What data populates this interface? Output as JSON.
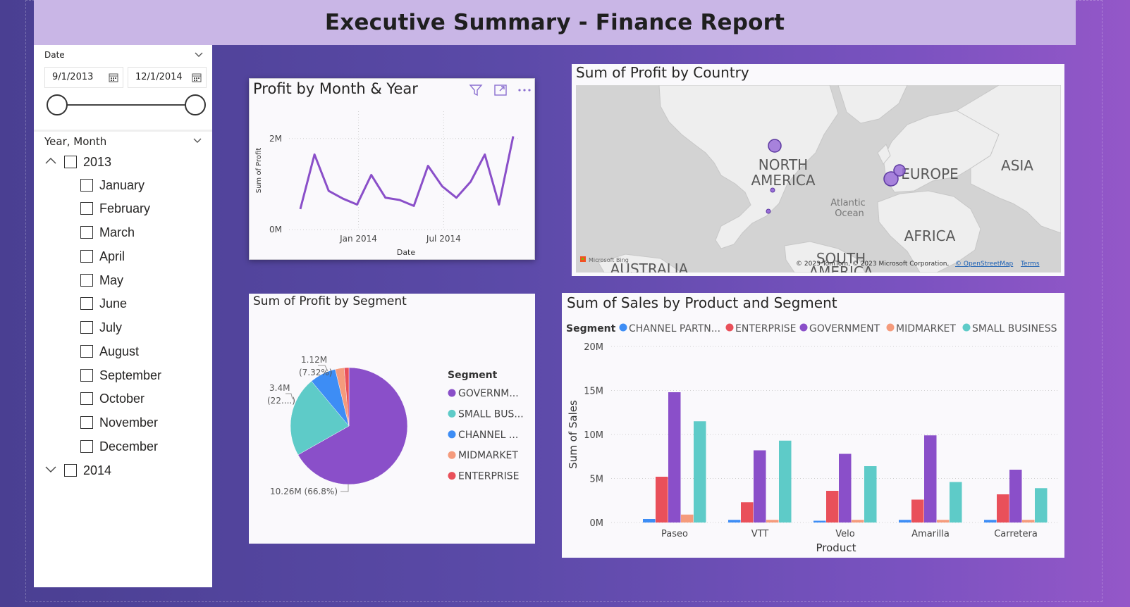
{
  "report": {
    "title": "Executive Summary - Finance Report"
  },
  "date_slicer": {
    "header": "Date",
    "start_date": "9/1/2013",
    "end_date": "12/1/2014",
    "range_fraction": [
      0.0,
      1.0
    ]
  },
  "hierarchy_slicer": {
    "header": "Year, Month",
    "years": [
      {
        "label": "2013",
        "expanded": true,
        "months": [
          "January",
          "February",
          "March",
          "April",
          "May",
          "June",
          "July",
          "August",
          "September",
          "October",
          "November",
          "December"
        ]
      },
      {
        "label": "2014",
        "expanded": false,
        "months": []
      }
    ]
  },
  "line_visual": {
    "title": "Profit by Month & Year",
    "header_icons": [
      "filter-icon",
      "focus-mode-icon",
      "more-options-icon"
    ]
  },
  "map_visual": {
    "title": "Sum of Profit by Country",
    "labels": [
      "NORTH AMERICA",
      "EUROPE",
      "ASIA",
      "Atlantic Ocean",
      "AFRICA",
      "SOUTH AMERICA",
      "AUSTRALIA"
    ],
    "label_lines": {
      "north_america": [
        "NORTH",
        "AMERICA"
      ],
      "atlantic": [
        "Atlantic",
        "Ocean"
      ],
      "south_america": [
        "SOUTH",
        "AMERICA"
      ]
    },
    "attribution": {
      "bing": "Microsoft Bing",
      "copyright": "© 2023 TomTom, © 2023 Microsoft Corporation,",
      "osm": "© OpenStreetMap",
      "terms": "Terms"
    },
    "bubbles": [
      {
        "place": "Canada",
        "relative_size": "large"
      },
      {
        "place": "United States of America",
        "relative_size": "small"
      },
      {
        "place": "Mexico",
        "relative_size": "small"
      },
      {
        "place": "France",
        "relative_size": "large"
      },
      {
        "place": "Germany",
        "relative_size": "large"
      }
    ]
  },
  "pie_visual": {
    "title": "Sum of Profit by Segment"
  },
  "bar_visual": {
    "title": "Sum of Sales by Product and Segment"
  },
  "colors": {
    "purple": "#8a4fc9",
    "teal": "#5ecbc8",
    "blue": "#3d8df5",
    "salmon": "#f59b7c",
    "red": "#e9505a",
    "title_bar": "#c9b6e6"
  },
  "chart_data": [
    {
      "id": "profit_by_month",
      "type": "line",
      "xlabel": "Date",
      "ylabel": "Sum of Profit",
      "x_ticks": [
        "Jan 2014",
        "Jul 2014"
      ],
      "y_ticks": [
        "0M",
        "2M"
      ],
      "ylim": [
        0,
        2.6
      ],
      "x": [
        "Sep 2013",
        "Oct 2013",
        "Nov 2013",
        "Dec 2013",
        "Jan 2014",
        "Feb 2014",
        "Mar 2014",
        "Apr 2014",
        "May 2014",
        "Jun 2014",
        "Jul 2014",
        "Aug 2014",
        "Sep 2014",
        "Oct 2014",
        "Nov 2014",
        "Dec 2014"
      ],
      "series": [
        {
          "color": "#8a4fc9",
          "values": [
            0.45,
            1.65,
            0.85,
            0.68,
            0.55,
            1.2,
            0.7,
            0.65,
            0.52,
            1.4,
            0.95,
            0.7,
            1.05,
            1.65,
            0.55,
            2.05
          ]
        }
      ],
      "grid": true
    },
    {
      "id": "profit_by_segment",
      "type": "pie",
      "legend_title": "Segment",
      "legend_placement": "right",
      "slices": [
        {
          "label": "GOVERNM...",
          "value": 10.26,
          "percent": 66.8,
          "color": "#8a4fc9",
          "data_label": [
            "10.26M (66.8%)"
          ]
        },
        {
          "label": "SMALL BUS...",
          "value": 3.4,
          "percent": 22.1,
          "color": "#5ecbc8",
          "data_label": [
            "3.4M",
            "(22....)"
          ]
        },
        {
          "label": "CHANNEL ...",
          "value": 1.12,
          "percent": 7.32,
          "color": "#3d8df5",
          "data_label": [
            "1.12M",
            "(7.32%)"
          ]
        },
        {
          "label": "MIDMARKET",
          "value": 0.38,
          "percent": 2.5,
          "color": "#f59b7c",
          "data_label": []
        },
        {
          "label": "ENTERPRISE",
          "value": 0.2,
          "percent": 1.3,
          "color": "#e9505a",
          "data_label": []
        }
      ]
    },
    {
      "id": "sales_by_product_segment",
      "type": "bar",
      "xlabel": "Product",
      "ylabel": "Sum of Sales",
      "legend_title": "Segment",
      "legend_placement": "top-left",
      "categories": [
        "Paseo",
        "VTT",
        "Velo",
        "Amarilla",
        "Carretera"
      ],
      "y_ticks": [
        "0M",
        "5M",
        "10M",
        "15M",
        "20M"
      ],
      "ylim": [
        0,
        20
      ],
      "series": [
        {
          "name": "CHANNEL PARTN...",
          "color": "#3d8df5",
          "values": [
            0.4,
            0.3,
            0.2,
            0.3,
            0.3
          ]
        },
        {
          "name": "ENTERPRISE",
          "color": "#e9505a",
          "values": [
            5.2,
            2.3,
            3.6,
            2.6,
            3.2
          ]
        },
        {
          "name": "GOVERNMENT",
          "color": "#8a4fc9",
          "values": [
            14.8,
            8.2,
            7.8,
            9.9,
            6.0
          ]
        },
        {
          "name": "MIDMARKET",
          "color": "#f59b7c",
          "values": [
            0.9,
            0.3,
            0.3,
            0.3,
            0.3
          ]
        },
        {
          "name": "SMALL BUSINESS",
          "color": "#5ecbc8",
          "values": [
            11.5,
            9.3,
            6.4,
            4.6,
            3.9
          ]
        }
      ],
      "grid": true
    }
  ]
}
